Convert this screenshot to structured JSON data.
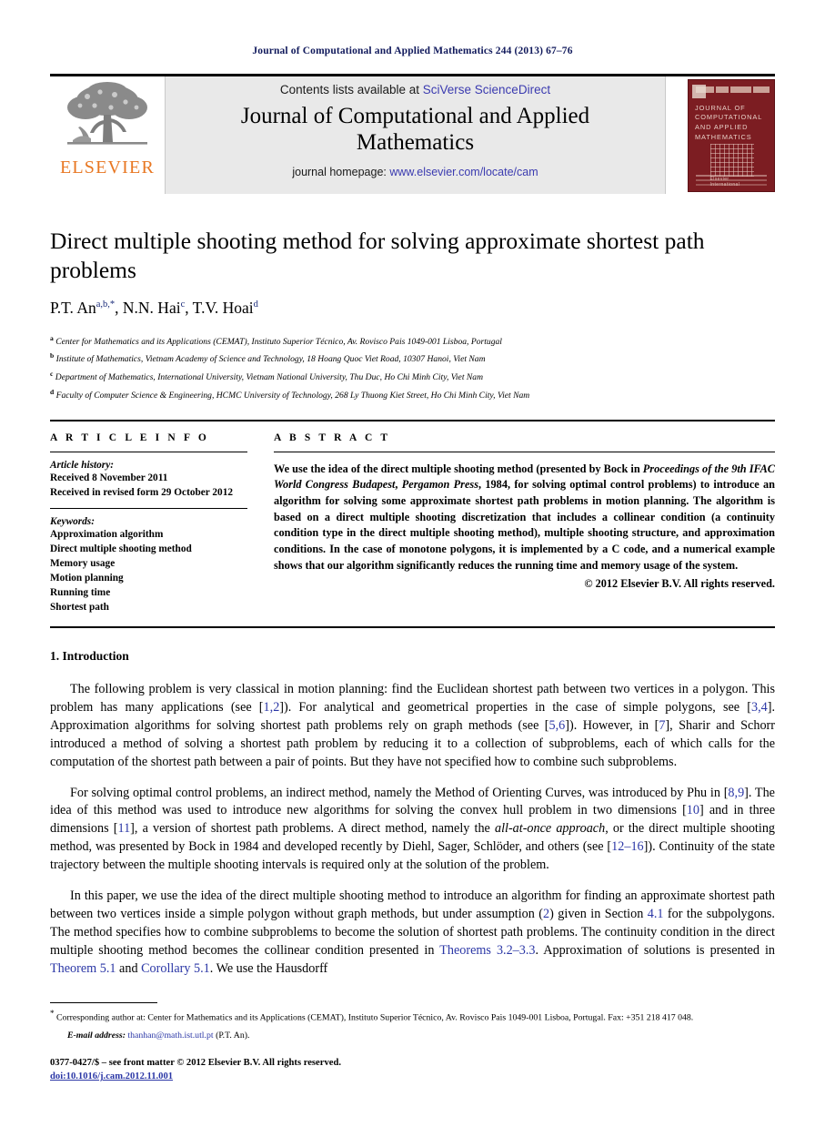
{
  "running_head": "Journal of Computational and Applied Mathematics 244 (2013) 67–76",
  "masthead": {
    "contents_prefix": "Contents lists available at ",
    "contents_link": "SciVerse ScienceDirect",
    "journal_title_line1": "Journal of Computational and Applied",
    "journal_title_line2": "Mathematics",
    "homepage_prefix": "journal homepage: ",
    "homepage_link": "www.elsevier.com/locate/cam",
    "publisher_wordmark": "ELSEVIER",
    "cover_title": "JOURNAL OF COMPUTATIONAL AND APPLIED MATHEMATICS",
    "cover_logo": "Elsevier International",
    "accent_orange": "#e87722",
    "link_blue": "#3b3bb0",
    "cover_red": "#7c1d22"
  },
  "article": {
    "title": "Direct multiple shooting method for solving approximate shortest path problems",
    "authors_html": "P.T. An<sup>a,b,*</sup>, N.N. Hai<sup>c</sup>, T.V. Hoai<sup>d</sup>",
    "affiliations": [
      {
        "marker": "a",
        "text": "Center for Mathematics and its Applications (CEMAT), Instituto Superior Técnico, Av. Rovisco Pais 1049-001 Lisboa, Portugal"
      },
      {
        "marker": "b",
        "text": "Institute of Mathematics, Vietnam Academy of Science and Technology, 18 Hoang Quoc Viet Road, 10307 Hanoi, Viet Nam"
      },
      {
        "marker": "c",
        "text": "Department of Mathematics, International University, Vietnam National University, Thu Duc, Ho Chi Minh City, Viet Nam"
      },
      {
        "marker": "d",
        "text": "Faculty of Computer Science & Engineering, HCMC University of Technology, 268 Ly Thuong Kiet Street, Ho Chi Minh City, Viet Nam"
      }
    ]
  },
  "info": {
    "heading": "A R T I C L E  I N F O",
    "history_label": "Article history:",
    "history": [
      "Received 8 November 2011",
      "Received in revised form 29 October 2012"
    ],
    "keywords_label": "Keywords:",
    "keywords": [
      "Approximation algorithm",
      "Direct multiple shooting method",
      "Memory usage",
      "Motion planning",
      "Running time",
      "Shortest path"
    ]
  },
  "abstract": {
    "heading": "A B S T R A C T",
    "text_html": "We use the idea of the direct multiple shooting method (presented by Bock in <i>Proceedings of the 9th IFAC World Congress Budapest</i>, <i>Pergamon Press</i>, 1984, for solving optimal control problems) to introduce an algorithm for solving some approximate shortest path problems in motion planning. The algorithm is based on a direct multiple shooting discretization that includes a collinear condition (a continuity condition type in the direct multiple shooting method), multiple shooting structure, and approximation conditions. In the case of monotone polygons, it is implemented by a C code, and a numerical example shows that our algorithm significantly reduces the running time and memory usage of the system.",
    "copyright": "© 2012 Elsevier B.V. All rights reserved."
  },
  "body": {
    "section_number_title": "1. Introduction",
    "paragraphs_html": [
      "The following problem is very classical in motion planning: find the Euclidean shortest path between two vertices in a polygon. This problem has many applications (see [<a class=\"ref\" href=\"#\" data-name=\"citation-link\">1,2</a>]). For analytical and geometrical properties in the case of simple polygons, see [<a class=\"ref\" href=\"#\" data-name=\"citation-link\">3,4</a>]. Approximation algorithms for solving shortest path problems rely on graph methods (see [<a class=\"ref\" href=\"#\" data-name=\"citation-link\">5,6</a>]). However, in [<a class=\"ref\" href=\"#\" data-name=\"citation-link\">7</a>], Sharir and Schorr introduced a method of solving a shortest path problem by reducing it to a collection of subproblems, each of which calls for the computation of the shortest path between a pair of points. But they have not specified how to combine such subproblems.",
      "For solving optimal control problems, an indirect method, namely the Method of Orienting Curves, was introduced by Phu in [<a class=\"ref\" href=\"#\" data-name=\"citation-link\">8,9</a>]. The idea of this method was used to introduce new algorithms for solving the convex hull problem in two dimensions [<a class=\"ref\" href=\"#\" data-name=\"citation-link\">10</a>] and in three dimensions [<a class=\"ref\" href=\"#\" data-name=\"citation-link\">11</a>], a version of shortest path problems. A direct method, namely the <i>all-at-once approach</i>, or the direct multiple shooting method, was presented by Bock in 1984 and developed recently by Diehl, Sager, Schlöder, and others (see [<a class=\"ref\" href=\"#\" data-name=\"citation-link\">12–16</a>]). Continuity of the state trajectory between the multiple shooting intervals is required only at the solution of the problem.",
      "In this paper, we use the idea of the direct multiple shooting method to introduce an algorithm for finding an approximate shortest path between two vertices inside a simple polygon without graph methods, but under assumption (<a class=\"ref\" href=\"#\" data-name=\"equation-link\">2</a>) given in Section <a class=\"ref\" href=\"#\" data-name=\"section-link\">4.1</a> for the subpolygons. The method specifies how to combine subproblems to become the solution of shortest path problems. The continuity condition in the direct multiple shooting method becomes the collinear condition presented in <a class=\"ref\" href=\"#\" data-name=\"theorem-link\">Theorems 3.2–3.3</a>. Approximation of solutions is presented in <a class=\"ref\" href=\"#\" data-name=\"theorem-link\">Theorem 5.1</a> and <a class=\"ref\" href=\"#\" data-name=\"corollary-link\">Corollary 5.1</a>. We use the Hausdorff"
    ]
  },
  "footnotes": {
    "corresponding_html": "<sup>*</sup> Corresponding author at: Center for Mathematics and its Applications (CEMAT), Instituto Superior Técnico, Av. Rovisco Pais 1049-001 Lisboa, Portugal. Fax: +351 218 417 048.",
    "email_label": "E-mail address:",
    "email": "thanhan@math.ist.utl.pt",
    "email_owner": "(P.T. An).",
    "issn_line": "0377-0427/$ – see front matter © 2012 Elsevier B.V. All rights reserved.",
    "doi": "doi:10.1016/j.cam.2012.11.001"
  }
}
